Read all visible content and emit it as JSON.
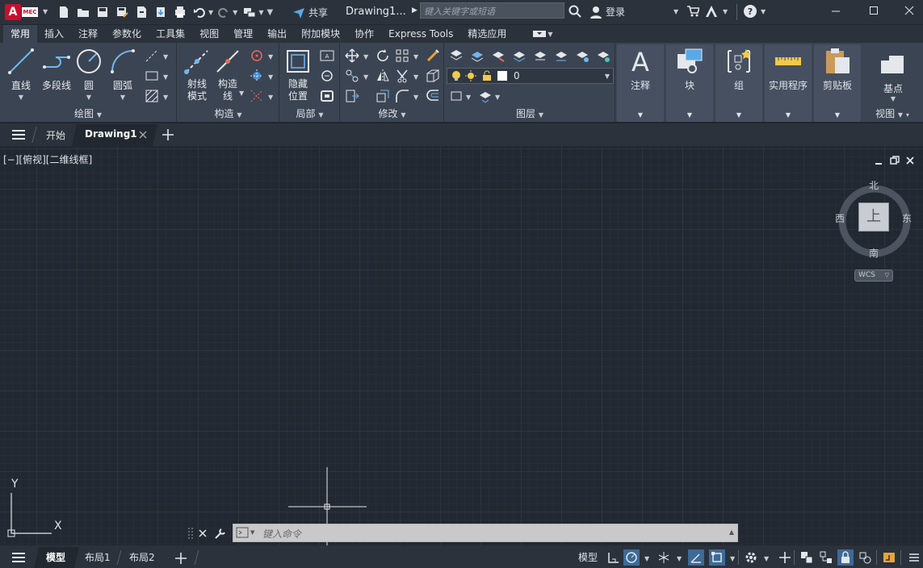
{
  "app": {
    "logo_text": "A",
    "logo_badge": "MEC"
  },
  "titlebar": {
    "share_label": "共享",
    "doc_title": "Drawing1...",
    "search_placeholder": "键入关键字或短语",
    "login_label": "登录"
  },
  "menubar": {
    "tabs": [
      "常用",
      "插入",
      "注释",
      "参数化",
      "工具集",
      "视图",
      "管理",
      "输出",
      "附加模块",
      "协作",
      "Express Tools",
      "精选应用"
    ]
  },
  "ribbon": {
    "draw": {
      "title": "绘图",
      "line": "直线",
      "polyline": "多段线",
      "circle": "圆",
      "arc": "圆弧"
    },
    "construct": {
      "title": "构造",
      "ray_l1": "射线",
      "ray_l2": "模式",
      "xline_l1": "构造",
      "xline_l2": "线"
    },
    "local": {
      "title": "局部",
      "hide_l1": "隐藏",
      "hide_l2": "位置"
    },
    "modify": {
      "title": "修改"
    },
    "layers": {
      "title": "图层",
      "current_layer": "0"
    },
    "annotation": {
      "label": "注释"
    },
    "block": {
      "label": "块"
    },
    "group": {
      "label": "组"
    },
    "utilities": {
      "label": "实用程序"
    },
    "clipboard": {
      "label": "剪贴板"
    },
    "view": {
      "label": "基点",
      "title": "视图"
    }
  },
  "filetabs": {
    "start": "开始",
    "drawing": "Drawing1"
  },
  "viewport": {
    "label": "[−][俯视][二维线框]",
    "viewcube": {
      "north": "北",
      "south": "南",
      "east": "东",
      "west": "西",
      "top": "上",
      "wcs": "WCS"
    },
    "ucs": {
      "y": "Y",
      "x": "X"
    }
  },
  "command": {
    "placeholder": "键入命令"
  },
  "status": {
    "model_tab": "模型",
    "layout1": "布局1",
    "layout2": "布局2",
    "model_button": "模型"
  },
  "colors": {
    "accent": "#3d8fd6",
    "brand": "#c8102e",
    "bg": "#222831"
  }
}
